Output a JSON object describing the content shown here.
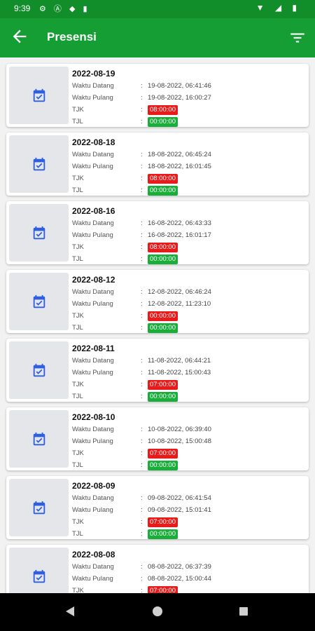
{
  "status_bar": {
    "time": "9:39"
  },
  "app_bar": {
    "title": "Presensi"
  },
  "labels": {
    "arrival": "Waktu Datang",
    "departure": "Waktu Pulang",
    "tjk": "TJK",
    "tjl": "TJL",
    "sep": ":"
  },
  "entries": [
    {
      "date": "2022-08-19",
      "arrival": "19-08-2022, 06:41:46",
      "departure": "19-08-2022, 16:00:27",
      "tjk": "08:00:00",
      "tjl": "00:00:00"
    },
    {
      "date": "2022-08-18",
      "arrival": "18-08-2022, 06:45:24",
      "departure": "18-08-2022, 16:01:45",
      "tjk": "08:00:00",
      "tjl": "00:00:00"
    },
    {
      "date": "2022-08-16",
      "arrival": "16-08-2022, 06:43:33",
      "departure": "16-08-2022, 16:01:17",
      "tjk": "08:00:00",
      "tjl": "00:00:00"
    },
    {
      "date": "2022-08-12",
      "arrival": "12-08-2022, 06:46:24",
      "departure": "12-08-2022, 11:23:10",
      "tjk": "00:00:00",
      "tjl": "00:00:00"
    },
    {
      "date": "2022-08-11",
      "arrival": "11-08-2022, 06:44:21",
      "departure": "11-08-2022, 15:00:43",
      "tjk": "07:00:00",
      "tjl": "00:00:00"
    },
    {
      "date": "2022-08-10",
      "arrival": "10-08-2022, 06:39:40",
      "departure": "10-08-2022, 15:00:48",
      "tjk": "07:00:00",
      "tjl": "00:00:00"
    },
    {
      "date": "2022-08-09",
      "arrival": "09-08-2022, 06:41:54",
      "departure": "09-08-2022, 15:01:41",
      "tjk": "07:00:00",
      "tjl": "00:00:00"
    },
    {
      "date": "2022-08-08",
      "arrival": "08-08-2022, 06:37:39",
      "departure": "08-08-2022, 15:00:44",
      "tjk": "07:00:00",
      "tjl": ""
    }
  ],
  "colors": {
    "primary": "#159e33",
    "tjk_badge": "#e81a1a",
    "tjl_badge": "#19ad3a",
    "calendar_icon": "#2d5fe0"
  },
  "icons": {
    "back": "arrow-left-icon",
    "filter": "filter-icon",
    "entry": "calendar-check-icon"
  }
}
